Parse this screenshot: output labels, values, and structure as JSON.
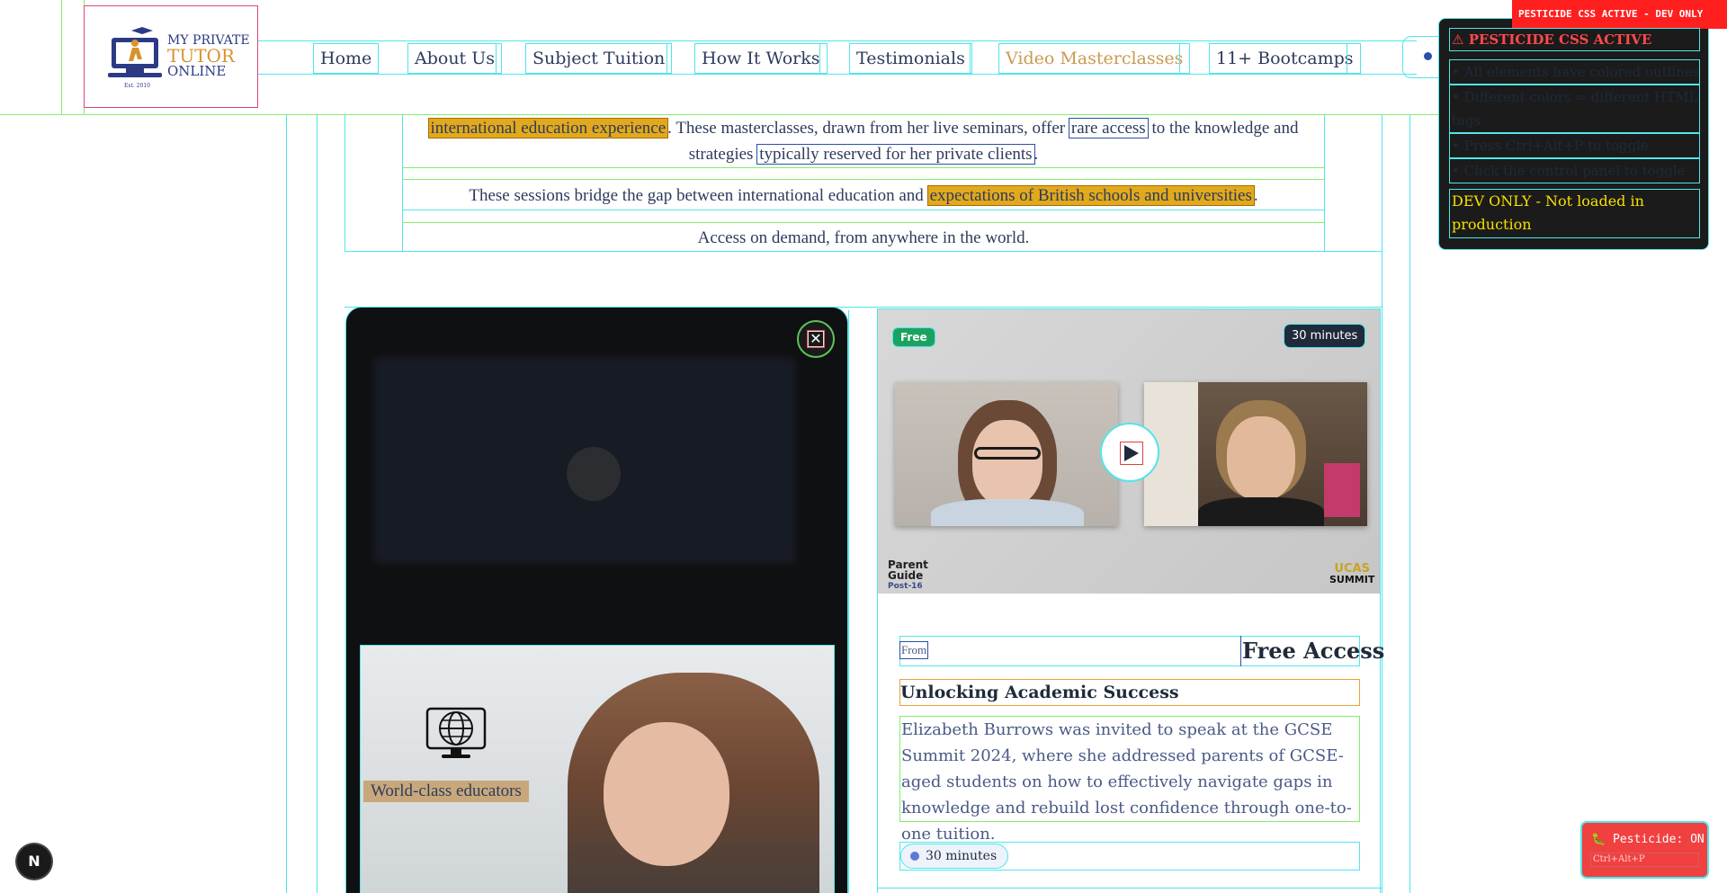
{
  "logo": {
    "line1": "MY PRIVATE",
    "line2": "TUTOR",
    "line3": "ONLINE",
    "est": "Est. 2010"
  },
  "nav": {
    "items": [
      {
        "label": "Home"
      },
      {
        "label": "About Us"
      },
      {
        "label": "Subject Tuition"
      },
      {
        "label": "How It Works"
      },
      {
        "label": "Testimonials"
      },
      {
        "label": "Video Masterclasses"
      },
      {
        "label": "11+ Bootcamps"
      }
    ],
    "active_index": 5
  },
  "intro": {
    "p1_hl1": "international education experience",
    "p1_a": ". These masterclasses, drawn from her live seminars, offer ",
    "p1_hl2": "rare access",
    "p1_b": " to the knowledge and",
    "p1_c": "strategies ",
    "p1_hl3": "typically reserved for her private clients",
    "p1_d": ".",
    "p2_a": "These sessions bridge the gap between international education and ",
    "p2_hl": "expectations of British schools and universities",
    "p2_b": ".",
    "p3": "Access on demand, from anywhere in the world."
  },
  "left_card": {
    "close_glyph": "✕",
    "feature_label": "World-class educators",
    "icon": "globe-monitor-icon"
  },
  "right_card": {
    "badge_free": "Free",
    "badge_duration": "30 minutes",
    "logo_parent": [
      "Parent",
      "Guide",
      "Post-16"
    ],
    "logo_ucas": [
      "UCAS",
      "SUMMIT"
    ],
    "price_from": "From",
    "price_value": "Free Access",
    "title": "Unlocking Academic Success",
    "description": "Elizabeth Burrows was invited to speak at the GCSE Summit 2024, where she addressed parents of GCSE-aged students on how to effectively navigate gaps in knowledge and rebuild lost confidence through one-to-one tuition.",
    "duration_pill": "30 minutes"
  },
  "pesticide": {
    "tag": "PESTICIDE CSS ACTIVE - DEV ONLY",
    "title": "PESTICIDE CSS ACTIVE",
    "rows": [
      "• All elements have colored outlines",
      "• Different colors = different HTML tags",
      "• Press Ctrl+Alt+P to toggle",
      "• Click the control panel to toggle"
    ],
    "prod_note": "DEV ONLY - Not loaded in production",
    "toggle_label": "Pesticide: ON",
    "toggle_shortcut": "Ctrl+Alt+P"
  },
  "dev_badge": "N",
  "colors": {
    "accent_amber": "#e2a91c",
    "nav_active": "#c99a52",
    "free_green": "#1ca260",
    "pesticide_red": "#ff1f1f"
  }
}
